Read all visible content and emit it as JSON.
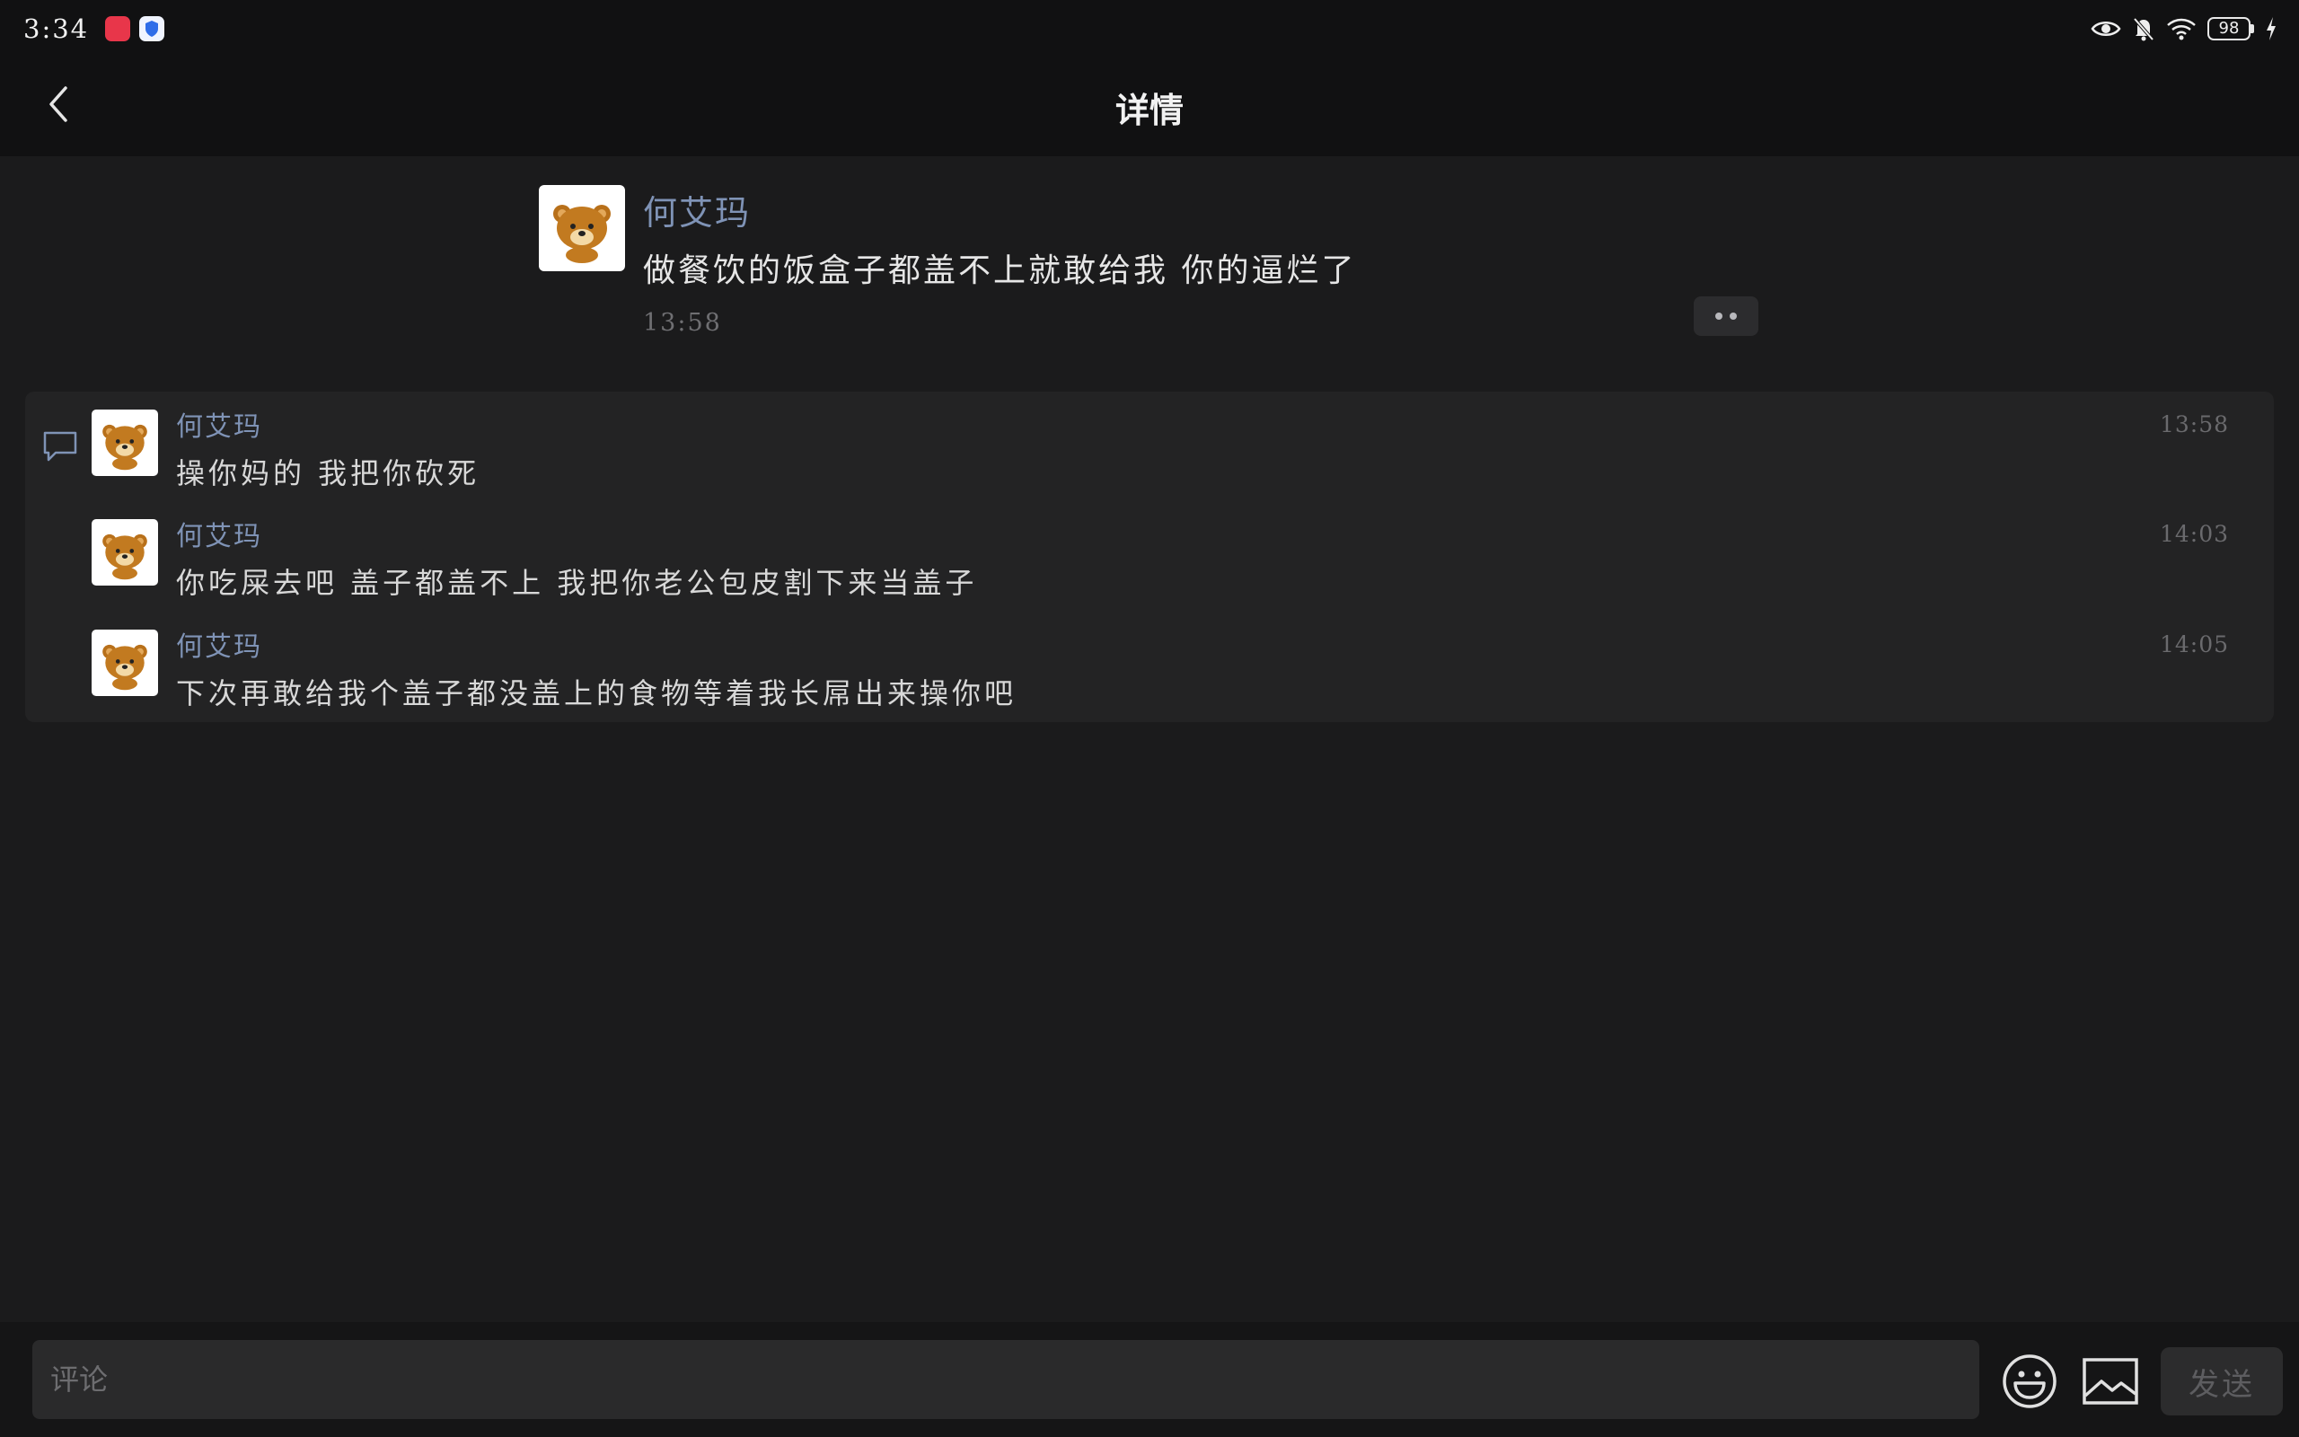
{
  "status_bar": {
    "time": "3:34",
    "battery": "98",
    "icons": [
      "app-badge-red",
      "shield-icon",
      "eye-icon",
      "mute-bell-icon",
      "wifi-icon",
      "battery-icon",
      "charging-icon"
    ]
  },
  "header": {
    "title": "详情",
    "back_icon": "chevron-left-icon"
  },
  "post": {
    "author": "何艾玛",
    "content": "做餐饮的饭盒子都盖不上就敢给我 你的逼烂了",
    "time": "13:58"
  },
  "comments": [
    {
      "author": "何艾玛",
      "text": "操你妈的 我把你砍死",
      "time": "13:58"
    },
    {
      "author": "何艾玛",
      "text": "你吃屎去吧 盖子都盖不上 我把你老公包皮割下来当盖子",
      "time": "14:03"
    },
    {
      "author": "何艾玛",
      "text": "下次再敢给我个盖子都没盖上的食物等着我长屌出来操你吧",
      "time": "14:05"
    }
  ],
  "input_bar": {
    "placeholder": "评论",
    "send_label": "发送"
  },
  "colors": {
    "background": "#1b1b1c",
    "author_name": "#7f93b6",
    "comments_panel": "#232324"
  }
}
